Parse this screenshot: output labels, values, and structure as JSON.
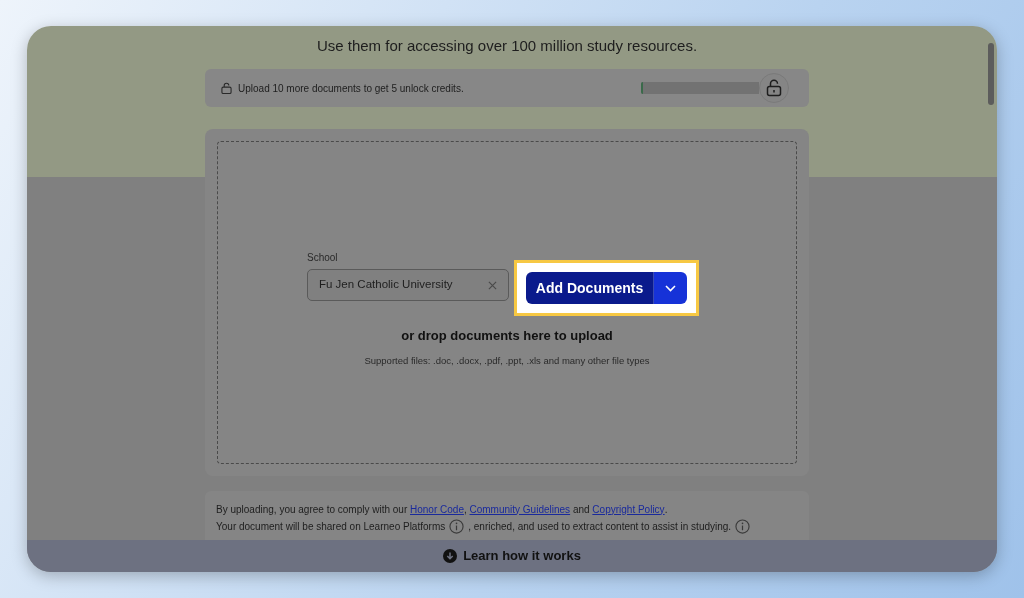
{
  "header": {
    "lines": [
      "Use them for accessing over 100 million study resources."
    ]
  },
  "progress": {
    "message": "Upload 10 more documents to get 5 unlock credits.",
    "level": 0.02
  },
  "upload": {
    "field_label": "School",
    "field_value": "Fu Jen Catholic University",
    "button": "Add Documents",
    "highlighted": true,
    "drop_text": "or drop documents here to upload",
    "supported": "Supported files: .doc, .docx, .pdf, .ppt, .xls and many other file types"
  },
  "terms": {
    "line_1": [
      {
        "kind": "text",
        "text": "By uploading, you agree to comply with our"
      },
      {
        "kind": "link",
        "text": "Honor Code"
      },
      {
        "kind": "text",
        "text": ","
      },
      {
        "kind": "link",
        "text": "Community Guidelines"
      },
      {
        "kind": "text",
        "text": "and"
      },
      {
        "kind": "link",
        "text": "Copyright Policy"
      },
      {
        "kind": "text",
        "text": "."
      }
    ],
    "line_2": [
      "Your document will be shared on Learneo Platforms",
      ", enriched, and used to extract content to assist in studying."
    ]
  },
  "footer": {
    "label": "Learn how it works"
  }
}
